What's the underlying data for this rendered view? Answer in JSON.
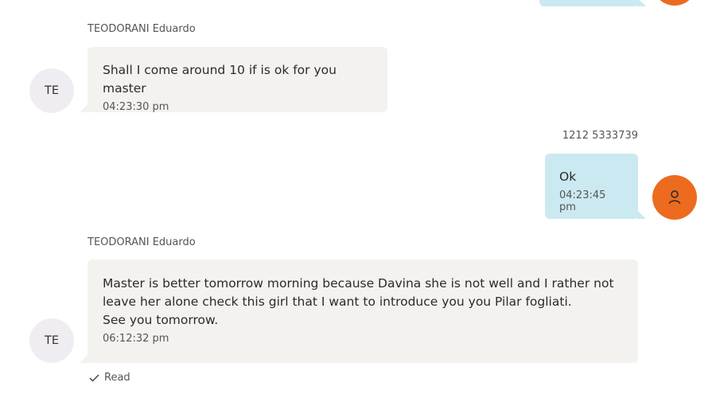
{
  "colors": {
    "incoming_bubble": "#f3f2ef",
    "outgoing_bubble": "#cbe9f0",
    "outgoing_avatar": "#ec6b1f",
    "incoming_avatar": "#efedf2"
  },
  "messages": [
    {
      "direction": "incoming",
      "sender": "TEODORANI Eduardo",
      "avatar_initials": "TE",
      "text": "Shall I come around 10 if is ok for you master",
      "time": "04:23:30 pm"
    },
    {
      "direction": "outgoing",
      "sender": "1212 5333739",
      "avatar_icon": "person-icon",
      "text": "Ok",
      "time": "04:23:45 pm"
    },
    {
      "direction": "incoming",
      "sender": "TEODORANI Eduardo",
      "avatar_initials": "TE",
      "text": "Master is better tomorrow morning because Davina she is not well and I rather not\nleave her alone check this girl that I want to introduce you you Pilar fogliati.\nSee you tomorrow.",
      "time": "06:12:32 pm"
    }
  ],
  "status": {
    "icon": "check-icon",
    "label": "Read"
  }
}
